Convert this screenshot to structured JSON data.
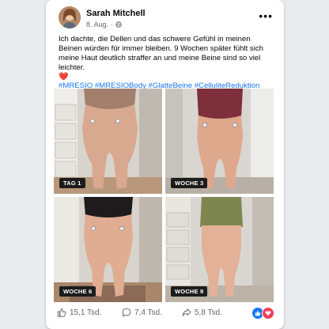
{
  "post": {
    "author": "Sarah Mitchell",
    "date": "8. Aug.",
    "separator": "·",
    "text": "Ich dachte, die Dellen und das schwere Gefühl in meinen Beinen würden für immer bleiben. 9 Wochen später fühlt sich meine Haut deutlich straffer an und meine Beine sind so viel leichter.",
    "heart": "❤️",
    "hashtags": "#MRESIO #MRESIOBody #GlatteBeine #CelluliteReduktion #Beinformung"
  },
  "photos": [
    {
      "label": "TAG 1"
    },
    {
      "label": "WOCHE 3"
    },
    {
      "label": "WOCHE 6"
    },
    {
      "label": "WOCHE 9"
    }
  ],
  "stats": {
    "likes": "15,1 Tsd.",
    "comments": "7,4 Tsd.",
    "shares": "5,8 Tsd."
  },
  "colors": {
    "link": "#1877f2",
    "like": "#1877f2",
    "love": "#f33e58"
  }
}
